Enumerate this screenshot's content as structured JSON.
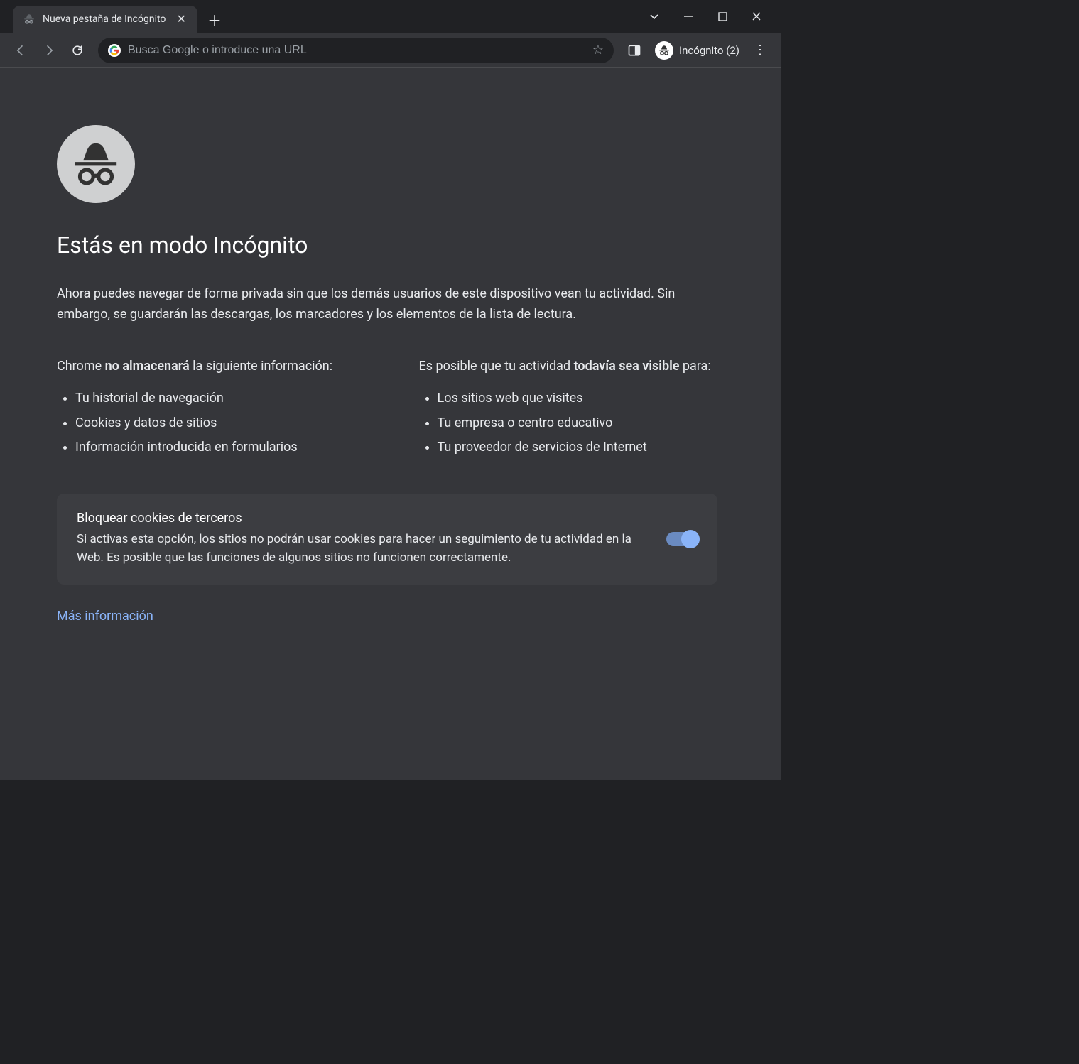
{
  "tab": {
    "title": "Nueva pestaña de Incógnito"
  },
  "omnibox": {
    "placeholder": "Busca Google o introduce una URL"
  },
  "incognito_badge": {
    "label": "Incógnito (2)"
  },
  "page": {
    "heading": "Estás en modo Incógnito",
    "intro": "Ahora puedes navegar de forma privada sin que los demás usuarios de este dispositivo vean tu actividad. Sin embargo, se guardarán las descargas, los marcadores y los elementos de la lista de lectura.",
    "col_left": {
      "prefix": "Chrome ",
      "strong": "no almacenará",
      "suffix": " la siguiente información:",
      "items": [
        "Tu historial de navegación",
        "Cookies y datos de sitios",
        "Información introducida en formularios"
      ]
    },
    "col_right": {
      "prefix": "Es posible que tu actividad ",
      "strong": "todavía sea visible",
      "suffix": " para:",
      "items": [
        "Los sitios web que visites",
        "Tu empresa o centro educativo",
        "Tu proveedor de servicios de Internet"
      ]
    },
    "cookie_box": {
      "title": "Bloquear cookies de terceros",
      "desc": "Si activas esta opción, los sitios no podrán usar cookies para hacer un seguimiento de tu actividad en la Web. Es posible que las funciones de algunos sitios no funcionen correctamente.",
      "toggle_on": true
    },
    "learn_more": "Más información"
  }
}
